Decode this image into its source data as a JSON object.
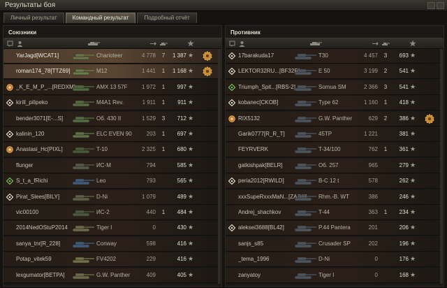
{
  "window": {
    "title": "Результаты боя"
  },
  "tabs": [
    {
      "label": "Личный результат",
      "active": false
    },
    {
      "label": "Командный результат",
      "active": true
    },
    {
      "label": "Подробный отчёт",
      "active": false
    }
  ],
  "allies": {
    "title": "Союзники",
    "rows": [
      {
        "name": "YarJagd[WCAT1]",
        "tank": "Charioteer",
        "damage": "4 778",
        "kills": "7",
        "xp": "1 387",
        "icon": "none",
        "medal": true,
        "highlight": true,
        "tank_color": "#6b7448"
      },
      {
        "name": "roman174_78[TTZ69]",
        "tank": "M12",
        "damage": "1 441",
        "kills": "1",
        "xp": "1 168",
        "icon": "none",
        "medal": true,
        "highlight": true,
        "tank_color": "#6a7a4a"
      },
      {
        "name": "_K_E_M_P_...[REDXM]",
        "tank": "AMX 13 57F",
        "damage": "1 972",
        "kills": "1",
        "xp": "997",
        "icon": "orange-emblem",
        "medal": false,
        "highlight": false,
        "tank_color": "#4d6a3e"
      },
      {
        "name": "kirill_pilipeko",
        "tank": "M4A1 Rev.",
        "damage": "1 911",
        "kills": "1",
        "xp": "911",
        "icon": "diamond-white",
        "medal": false,
        "highlight": false,
        "tank_color": "#5a6a40"
      },
      {
        "name": "bender3071[E-...S]",
        "tank": "Об. 430 II",
        "damage": "1 529",
        "kills": "3",
        "xp": "712",
        "icon": "none",
        "medal": false,
        "highlight": false,
        "tank_color": "#556b43"
      },
      {
        "name": "kalinin_120",
        "tank": "ELC EVEN 90",
        "damage": "203",
        "kills": "1",
        "xp": "697",
        "icon": "diamond-white",
        "medal": false,
        "highlight": false,
        "tank_color": "#5d7345"
      },
      {
        "name": "Anastasi_Hc[PIXL]",
        "tank": "T-10",
        "damage": "2 325",
        "kills": "1",
        "xp": "680",
        "icon": "orange-emblem",
        "medal": false,
        "highlight": false,
        "tank_color": "#4b5a3a"
      },
      {
        "name": "flunger",
        "tank": "ИС-М",
        "damage": "794",
        "kills": "",
        "xp": "585",
        "icon": "none",
        "medal": false,
        "highlight": false,
        "tank_color": "#555a48"
      },
      {
        "name": "S_t_a_fRichi",
        "tank": "Leo",
        "damage": "793",
        "kills": "",
        "xp": "565",
        "icon": "diamond-green",
        "medal": false,
        "highlight": false,
        "tank_color": "#3f5a7a"
      },
      {
        "name": "Pirat_Slees[BILY]",
        "tank": "D-Ni",
        "damage": "1 079",
        "kills": "",
        "xp": "489",
        "icon": "diamond-white",
        "medal": false,
        "highlight": false,
        "tank_color": "#5b6044"
      },
      {
        "name": "vic00100",
        "tank": "ИС-2",
        "damage": "440",
        "kills": "1",
        "xp": "484",
        "icon": "none",
        "medal": false,
        "highlight": false,
        "tank_color": "#4b5a3a"
      },
      {
        "name": "2014NedOStuP2014",
        "tank": "Tiger I",
        "damage": "0",
        "kills": "",
        "xp": "430",
        "icon": "none",
        "medal": false,
        "highlight": false,
        "tank_color": "#6b6a4a"
      },
      {
        "name": "sanya_tnr[R_228]",
        "tank": "Conway",
        "damage": "598",
        "kills": "",
        "xp": "416",
        "icon": "none",
        "medal": false,
        "highlight": false,
        "tank_color": "#3f5a7a"
      },
      {
        "name": "Potap_vitek59",
        "tank": "FV4202",
        "damage": "229",
        "kills": "",
        "xp": "416",
        "icon": "none",
        "medal": false,
        "highlight": false,
        "tank_color": "#6f7146"
      },
      {
        "name": "lexgumator[BETPA]",
        "tank": "G.W. Panther",
        "damage": "409",
        "kills": "",
        "xp": "405",
        "icon": "none",
        "medal": false,
        "highlight": false,
        "tank_color": "#6b6a4a"
      }
    ]
  },
  "enemies": {
    "title": "Противник",
    "rows": [
      {
        "name": "17barakuda17",
        "tank": "T30",
        "damage": "4 457",
        "kills": "3",
        "xp": "693",
        "icon": "diamond-white",
        "medal": false,
        "highlight": false,
        "tank_color": "#4a5560"
      },
      {
        "name": "LEKTOR32RU...[BF32R]",
        "tank": "E 50",
        "damage": "3 199",
        "kills": "2",
        "xp": "541",
        "icon": "diamond-white",
        "medal": false,
        "highlight": false,
        "tank_color": "#4d5560"
      },
      {
        "name": "Triumph_Spit...[RBS-2]",
        "tank": "Somua SM",
        "damage": "2 366",
        "kills": "3",
        "xp": "541",
        "icon": "diamond-green",
        "medal": false,
        "highlight": false,
        "tank_color": "#4a5560"
      },
      {
        "name": "kobanec[CKOB]",
        "tank": "Type 62",
        "damage": "1 160",
        "kills": "1",
        "xp": "418",
        "icon": "diamond-white",
        "medal": false,
        "highlight": false,
        "tank_color": "#4d5560"
      },
      {
        "name": "RIX5132",
        "tank": "G.W. Panther",
        "damage": "629",
        "kills": "2",
        "xp": "386",
        "icon": "orange-emblem",
        "medal": true,
        "highlight": false,
        "tank_color": "#4a5560"
      },
      {
        "name": "Garik0777[R_R_T]",
        "tank": "45TP",
        "damage": "1 221",
        "kills": "",
        "xp": "381",
        "icon": "none",
        "medal": false,
        "highlight": false,
        "tank_color": "#4d5560"
      },
      {
        "name": "FEYRVERK",
        "tank": "T-34/100",
        "damage": "762",
        "kills": "1",
        "xp": "361",
        "icon": "none",
        "medal": false,
        "highlight": false,
        "tank_color": "#4a5560"
      },
      {
        "name": "gatkishpak[BELR]",
        "tank": "Об. 257",
        "damage": "965",
        "kills": "",
        "xp": "279",
        "icon": "none",
        "medal": false,
        "highlight": false,
        "tank_color": "#4d5560"
      },
      {
        "name": "peria2012[RWILD]",
        "tank": "B-C 12 t",
        "damage": "578",
        "kills": "",
        "xp": "262",
        "icon": "diamond-white",
        "medal": false,
        "highlight": false,
        "tank_color": "#4a5560"
      },
      {
        "name": "xxxSupeRxxxMaN...[ZAJKI]",
        "tank": "Rhm.-B. WT",
        "damage": "386",
        "kills": "",
        "xp": "246",
        "icon": "none",
        "medal": false,
        "highlight": false,
        "tank_color": "#4d5560"
      },
      {
        "name": "Andrej_shachkov",
        "tank": "T-44",
        "damage": "363",
        "kills": "1",
        "xp": "234",
        "icon": "none",
        "medal": false,
        "highlight": false,
        "tank_color": "#4a5560"
      },
      {
        "name": "aleksei3688[BL42]",
        "tank": "P.44 Pantera",
        "damage": "201",
        "kills": "",
        "xp": "206",
        "icon": "diamond-white",
        "medal": false,
        "highlight": false,
        "tank_color": "#4d5560"
      },
      {
        "name": "sanjs_s85",
        "tank": "Crusader SP",
        "damage": "202",
        "kills": "",
        "xp": "196",
        "icon": "none",
        "medal": false,
        "highlight": false,
        "tank_color": "#4a5560"
      },
      {
        "name": "_tema_1996",
        "tank": "D-Ni",
        "damage": "0",
        "kills": "",
        "xp": "176",
        "icon": "none",
        "medal": false,
        "highlight": false,
        "tank_color": "#4d5560"
      },
      {
        "name": "zanyatoy",
        "tank": "Tiger I",
        "damage": "0",
        "kills": "",
        "xp": "168",
        "icon": "none",
        "medal": false,
        "highlight": false,
        "tank_color": "#4a5560"
      }
    ]
  },
  "header_icons": [
    "platoon-icon",
    "player-icon",
    "tank-icon",
    "damage-icon",
    "kills-icon",
    "xp-star-icon"
  ],
  "colors": {
    "accent": "#d6a04a",
    "ally_highlight": "#5a4532",
    "medal": "#c98a2c"
  }
}
